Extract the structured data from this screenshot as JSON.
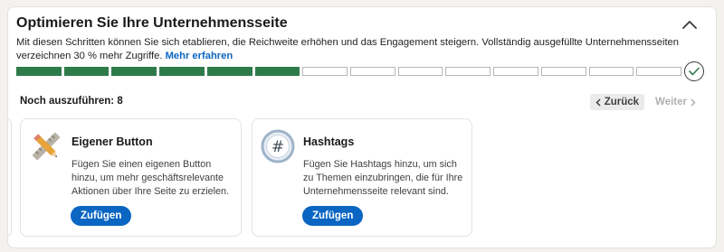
{
  "header": {
    "title": "Optimieren Sie Ihre Unternehmensseite",
    "collapse_icon": "chevron-up-icon"
  },
  "description": {
    "text": "Mit diesen Schritten können Sie sich etablieren, die Reichweite erhöhen und das Engagement steigern. Vollständig ausgefüllte Unternehmensseiten verzeichnen 30 % mehr Zugriffe. ",
    "link_label": "Mehr erfahren"
  },
  "progress": {
    "completed_steps": 6,
    "total_steps": 14,
    "complete_color": "#2e7b4a",
    "end_icon": "checkmark-circle-icon"
  },
  "remaining": {
    "label": "Noch auszuführen: 8"
  },
  "navigation": {
    "back_label": "Zurück",
    "next_label": "Weiter"
  },
  "cards": [
    {
      "title": "Eigener Button",
      "text": "Fügen Sie einen eigenen Button hinzu, um mehr geschäftsrelevante Aktionen über Ihre Seite zu erzielen.",
      "button_label": "Zufügen",
      "icon": "ruler-pencil-icon"
    },
    {
      "title": "Hashtags",
      "text": "Fügen Sie Hashtags hinzu, um sich zu Themen einzubringen, die für Ihre Unternehmensseite relevant sind.",
      "button_label": "Zufügen",
      "icon": "hashtag-icon"
    }
  ],
  "colors": {
    "accent": "#0a66c2",
    "progress_done": "#2e7b4a"
  }
}
